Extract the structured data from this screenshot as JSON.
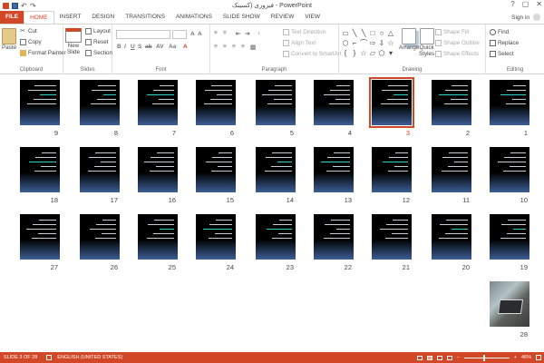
{
  "titlebar": {
    "title": "فیزوری (کسینک - PowerPoint",
    "min": "?",
    "restore": "▢",
    "close": "✕"
  },
  "tabs": [
    "FILE",
    "HOME",
    "INSERT",
    "DESIGN",
    "TRANSITIONS",
    "ANIMATIONS",
    "SLIDE SHOW",
    "REVIEW",
    "VIEW"
  ],
  "account": {
    "sign_in": "Sign in"
  },
  "ribbon": {
    "clipboard": {
      "paste": "Paste",
      "cut": "Cut",
      "copy": "Copy",
      "format_painter": "Format Painter",
      "label": "Clipboard"
    },
    "slides": {
      "new_slide": "New",
      "new_slide2": "Slide",
      "layout": "Layout",
      "reset": "Reset",
      "section": "Section",
      "label": "Slides"
    },
    "font": {
      "label": "Font",
      "font_name": "",
      "font_size": ""
    },
    "paragraph": {
      "text_direction": "Text Direction",
      "align_text": "Align Text",
      "convert": "Convert to SmartArt",
      "label": "Paragraph"
    },
    "drawing": {
      "arrange": "Arrange",
      "quick_styles": "Quick",
      "quick_styles2": "Styles",
      "shape_fill": "Shape Fill",
      "shape_outline": "Shape Outline",
      "shape_effects": "Shape Effects",
      "label": "Drawing"
    },
    "editing": {
      "find": "Find",
      "replace": "Replace",
      "select": "Select",
      "label": "Editing"
    }
  },
  "slides": [
    {
      "number": "1"
    },
    {
      "number": "2"
    },
    {
      "number": "3",
      "selected": true
    },
    {
      "number": "4"
    },
    {
      "number": "5"
    },
    {
      "number": "6"
    },
    {
      "number": "7"
    },
    {
      "number": "8"
    },
    {
      "number": "9"
    },
    {
      "number": "10"
    },
    {
      "number": "11"
    },
    {
      "number": "12"
    },
    {
      "number": "13"
    },
    {
      "number": "14"
    },
    {
      "number": "15"
    },
    {
      "number": "16"
    },
    {
      "number": "17"
    },
    {
      "number": "18"
    },
    {
      "number": "19"
    },
    {
      "number": "20"
    },
    {
      "number": "21"
    },
    {
      "number": "22"
    },
    {
      "number": "23"
    },
    {
      "number": "24"
    },
    {
      "number": "25"
    },
    {
      "number": "26"
    },
    {
      "number": "27"
    },
    {
      "number": "28",
      "photo": true
    }
  ],
  "status": {
    "slide": "SLIDE 3 OF 28",
    "language": "ENGLISH (UNITED STATES)",
    "zoom": "46%"
  },
  "colors": {
    "accent": "#d24726",
    "slide_bg": "#000000",
    "slide_gradient": "#3d5f95",
    "highlight_text": "#2cd6c6"
  }
}
